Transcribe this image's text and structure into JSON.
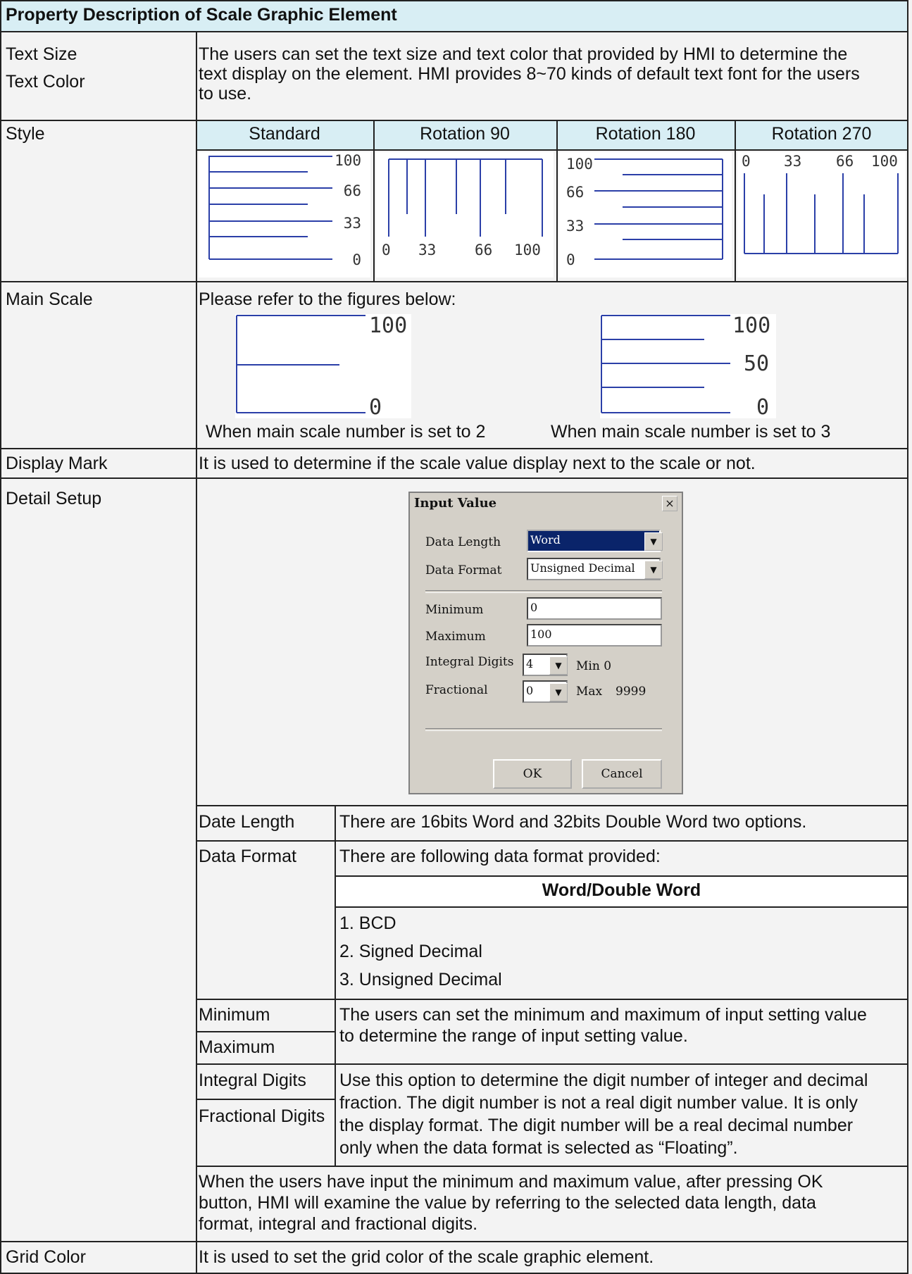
{
  "header": "Property Description of Scale Graphic Element",
  "text_size": {
    "label1": "Text Size",
    "label2": "Text Color",
    "desc_lines": [
      "The users can set the text size and text color that provided by HMI to determine the",
      "text display on the element. HMI provides 8~70 kinds of default text font for the users",
      "to use."
    ]
  },
  "style": {
    "label": "Style",
    "columns": [
      "Standard",
      "Rotation 90",
      "Rotation 180",
      "Rotation 270"
    ],
    "ticks_standard": [
      "100",
      "66",
      "33",
      "0"
    ],
    "ticks_rot90": [
      "0",
      "33",
      "66",
      "100"
    ],
    "ticks_rot180": [
      "100",
      "66",
      "33",
      "0"
    ],
    "ticks_rot270": [
      "0",
      "33",
      "66",
      "100"
    ]
  },
  "main_scale": {
    "label": "Main Scale",
    "intro": "Please refer to the figures below:",
    "fig1_ticks": [
      "100",
      "0"
    ],
    "fig2_ticks": [
      "100",
      "50",
      "0"
    ],
    "caption1": "When main scale number is set to 2",
    "caption2": "When main scale number is set to 3"
  },
  "display_mark": {
    "label": "Display Mark",
    "desc": "It is used to determine if the scale value display next to the scale or not."
  },
  "detail_setup": {
    "label": "Detail Setup",
    "dialog": {
      "title": "Input Value",
      "close": "×",
      "data_length_label": "Data Length",
      "data_length_value": "Word",
      "data_format_label": "Data Format",
      "data_format_value": "Unsigned Decimal",
      "minimum_label": "Minimum",
      "minimum_value": "0",
      "maximum_label": "Maximum",
      "maximum_value": "100",
      "integral_label": "Integral Digits",
      "integral_value": "4",
      "fractional_label": "Fractional",
      "fractional_value": "0",
      "min_text": "Min 0",
      "max_text": "Max",
      "max_value": "9999",
      "ok": "OK",
      "cancel": "Cancel"
    },
    "date_length": {
      "label": "Date Length",
      "desc": "There are 16bits Word and 32bits Double Word two options."
    },
    "data_format": {
      "label": "Data Format",
      "desc": "There are following data format provided:",
      "subheader": "Word/Double Word",
      "items": [
        "1. BCD",
        "2. Signed Decimal",
        "3. Unsigned Decimal"
      ]
    },
    "minmax": {
      "label_min": "Minimum",
      "label_max": "Maximum",
      "desc_lines": [
        "The users can set the minimum and maximum of input setting value",
        "to determine the range of input setting value."
      ]
    },
    "digits": {
      "label_int": "Integral Digits",
      "label_frac": "Fractional Digits",
      "desc_lines": [
        "Use this option to determine the digit number of integer and decimal",
        "fraction. The digit number is not a real digit number value. It is only",
        "the display format. The digit number will be a real decimal number",
        "only when the data format is selected as “Floating”."
      ]
    },
    "note_lines": [
      "When the users have input the minimum and maximum value, after pressing OK",
      "button, HMI will examine the value by referring to the selected data length, data",
      "format, integral and fractional digits."
    ]
  },
  "grid_color": {
    "label": "Grid Color",
    "desc": "It is used to set the grid color of the scale graphic element."
  },
  "colors": {
    "header_bg": "#d8eef4",
    "line": "#2b3fa8",
    "border": "#222222"
  }
}
